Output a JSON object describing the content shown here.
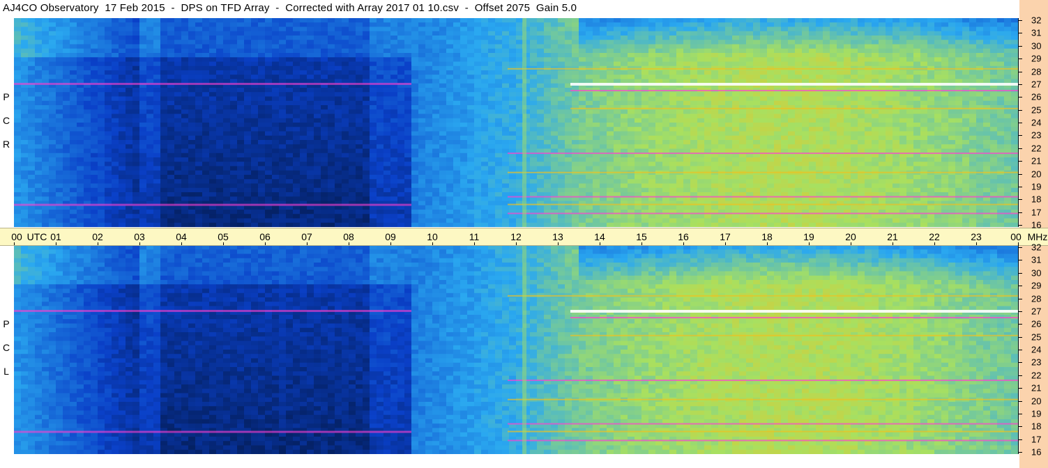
{
  "title": "AJ4CO Observatory  17 Feb 2015  -  DPS on TFD Array  -  Corrected with Array 2017 01 10.csv  -  Offset 2075  Gain 5.0",
  "chart_data": {
    "type": "heatmap",
    "panels": [
      {
        "name": "rcp",
        "label": [
          "R",
          "C",
          "P"
        ]
      },
      {
        "name": "lcp",
        "label": [
          "L",
          "C",
          "P"
        ]
      }
    ],
    "x_axis": {
      "unit_label": "UTC",
      "ticks": [
        "00",
        "01",
        "02",
        "03",
        "04",
        "05",
        "06",
        "07",
        "08",
        "09",
        "10",
        "11",
        "12",
        "13",
        "14",
        "15",
        "16",
        "17",
        "18",
        "19",
        "20",
        "21",
        "22",
        "23",
        "00"
      ],
      "range_hours": [
        0,
        24
      ]
    },
    "y_axis": {
      "unit_label": "MHz",
      "ticks": [
        "16",
        "17",
        "18",
        "19",
        "20",
        "21",
        "22",
        "23",
        "24",
        "25",
        "26",
        "27",
        "28",
        "29",
        "30",
        "31",
        "32"
      ],
      "range_mhz": [
        16,
        32
      ]
    },
    "colors": {
      "low": "#000814",
      "mid_low": "#0a40c8",
      "mid": "#2aa8f0",
      "mid_high": "#a8e060",
      "high": "#f0c020",
      "peak": "#ff40d0",
      "saturated": "#ffffff"
    }
  }
}
